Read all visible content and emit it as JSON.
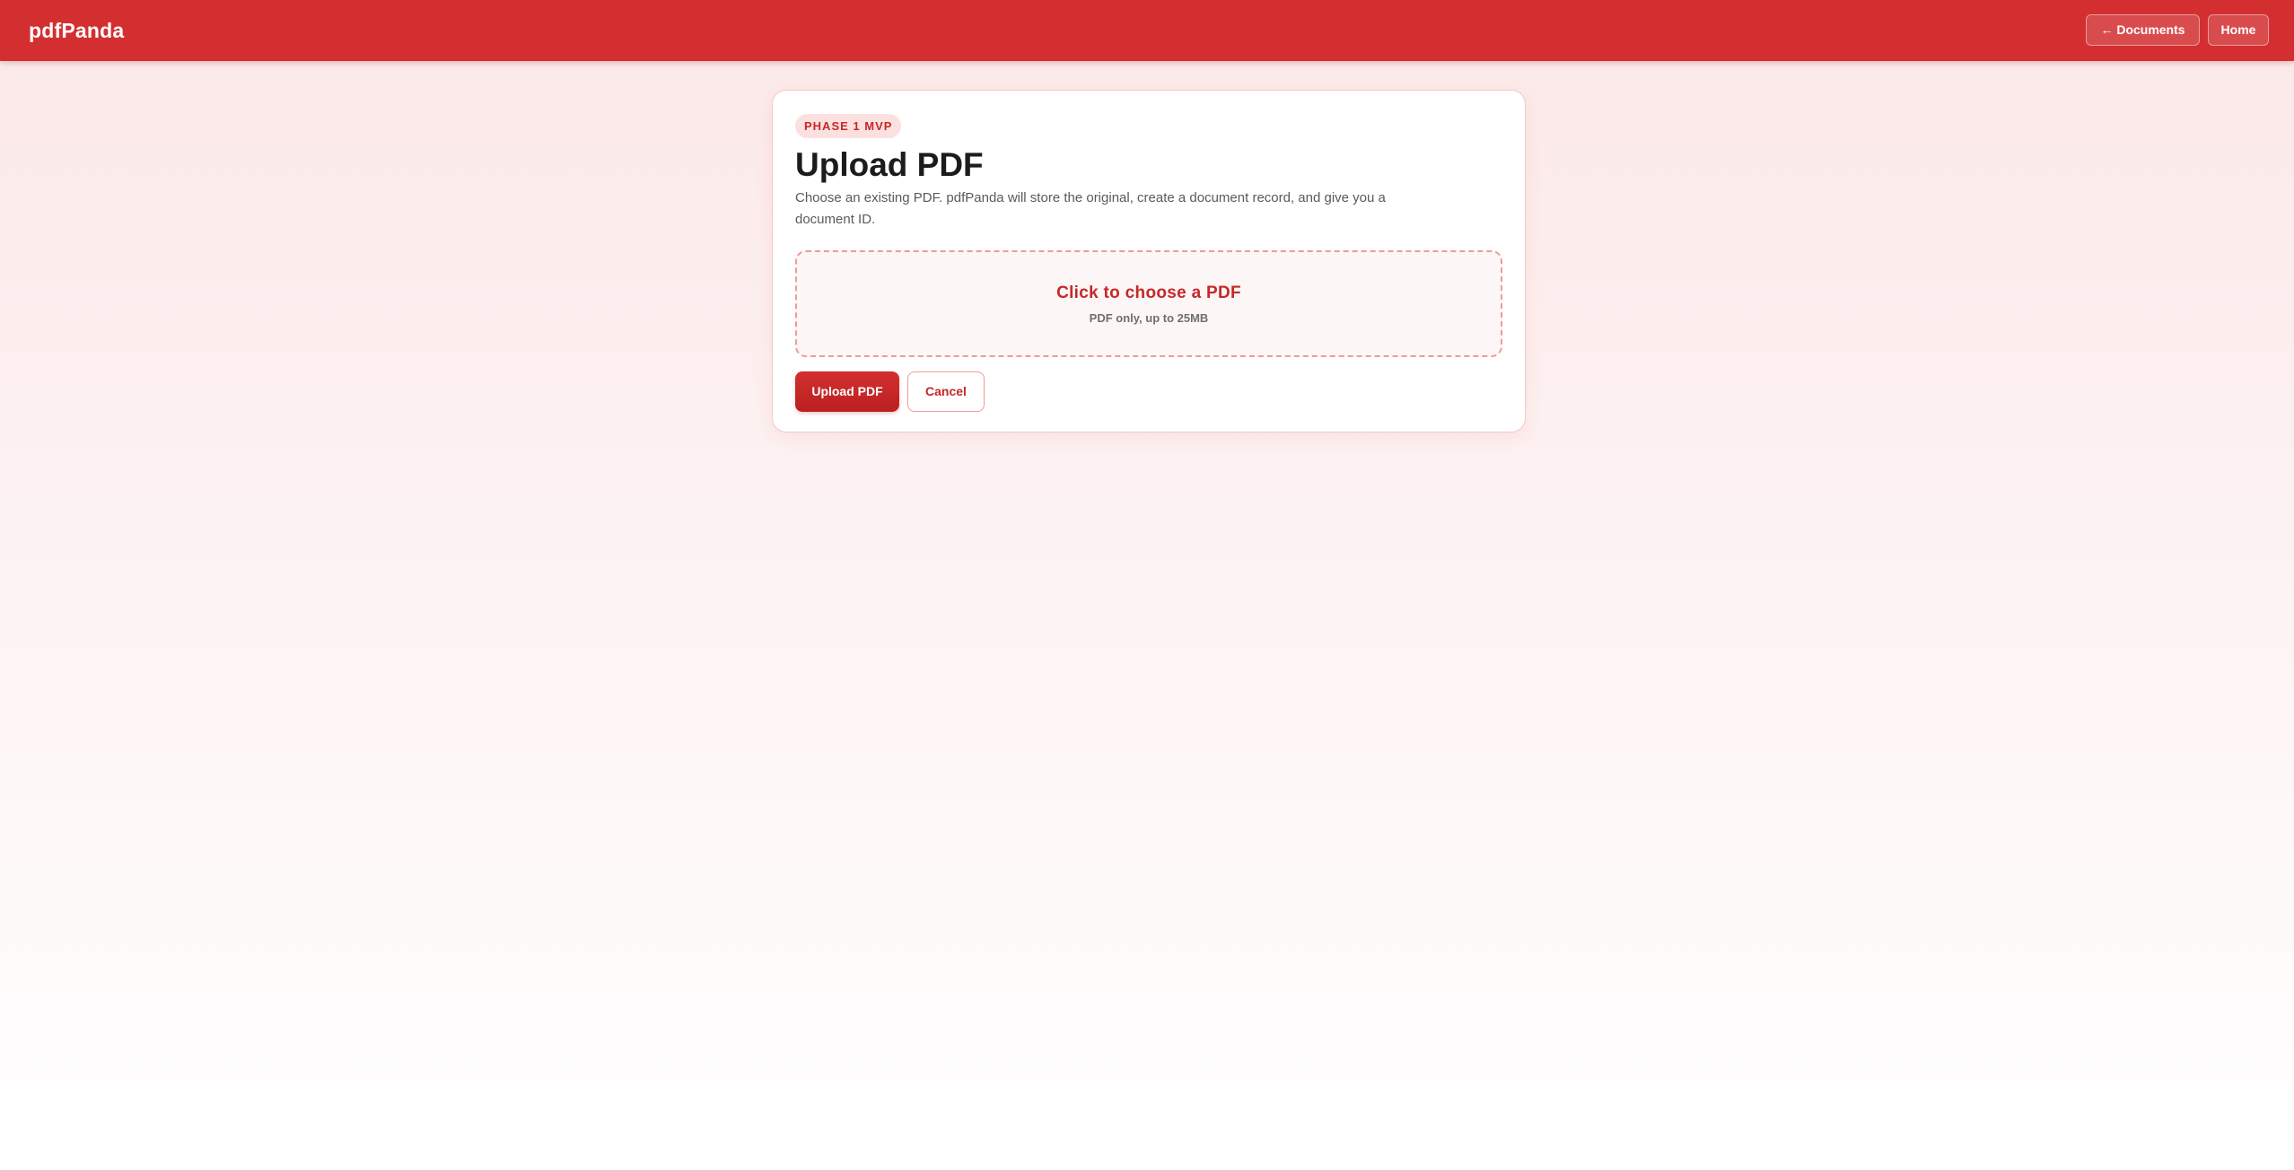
{
  "app": {
    "brand": "pdfPanda"
  },
  "nav": {
    "documents_label": "← Documents",
    "home_label": "Home"
  },
  "card": {
    "badge": "PHASE 1 MVP",
    "title": "Upload PDF",
    "description": "Choose an existing PDF. pdfPanda will store the original, create a document record, and give you a document ID."
  },
  "dropzone": {
    "title": "Click to choose a PDF",
    "subtitle": "PDF only, up to 25MB"
  },
  "actions": {
    "upload_label": "Upload PDF",
    "cancel_label": "Cancel"
  },
  "colors": {
    "brand_red": "#d32f30",
    "accent_red": "#c62828",
    "badge_bg": "#fbe0e0",
    "dropzone_border": "#ef9a9a"
  }
}
